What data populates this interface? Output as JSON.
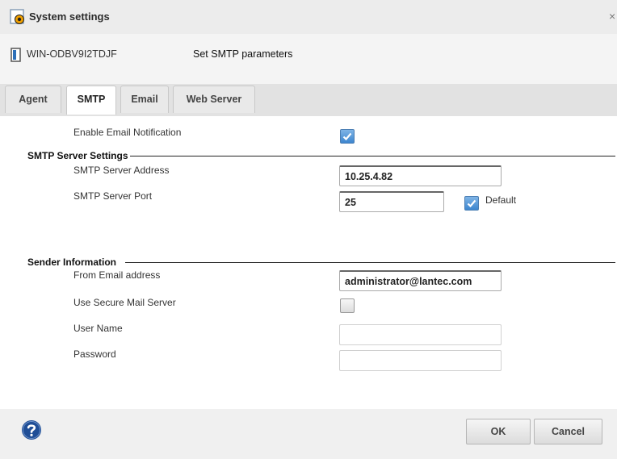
{
  "window": {
    "title": "System settings",
    "icon": "settings-gear-icon",
    "close_icon": "close-icon",
    "close_glyph": "×"
  },
  "header": {
    "host_icon": "server-icon",
    "host_name": "WIN-ODBV9I2TDJF",
    "description": "Set SMTP parameters"
  },
  "tabs": [
    {
      "label": "Agent",
      "active": false
    },
    {
      "label": "SMTP",
      "active": true
    },
    {
      "label": "Email",
      "active": false
    },
    {
      "label": "Web Server",
      "active": false
    }
  ],
  "form": {
    "enable_notification": {
      "label": "Enable Email Notification",
      "checked": true
    },
    "smtp_section": {
      "title": "SMTP Server Settings",
      "address": {
        "label": "SMTP Server Address",
        "value": "10.25.4.82"
      },
      "port": {
        "label": "SMTP Server Port",
        "value": "25"
      },
      "default": {
        "label": "Default",
        "checked": true
      }
    },
    "sender_section": {
      "title": "Sender Information",
      "from": {
        "label": "From Email address",
        "value": "administrator@lantec.com"
      },
      "secure": {
        "label": "Use Secure Mail Server",
        "checked": false
      },
      "username": {
        "label": "User Name",
        "value": ""
      },
      "password": {
        "label": "Password",
        "value": ""
      }
    }
  },
  "footer": {
    "help_icon": "help-icon",
    "ok_label": "OK",
    "cancel_label": "Cancel"
  },
  "colors": {
    "accent": "#3d86cf",
    "help_blue": "#1f4e96"
  }
}
